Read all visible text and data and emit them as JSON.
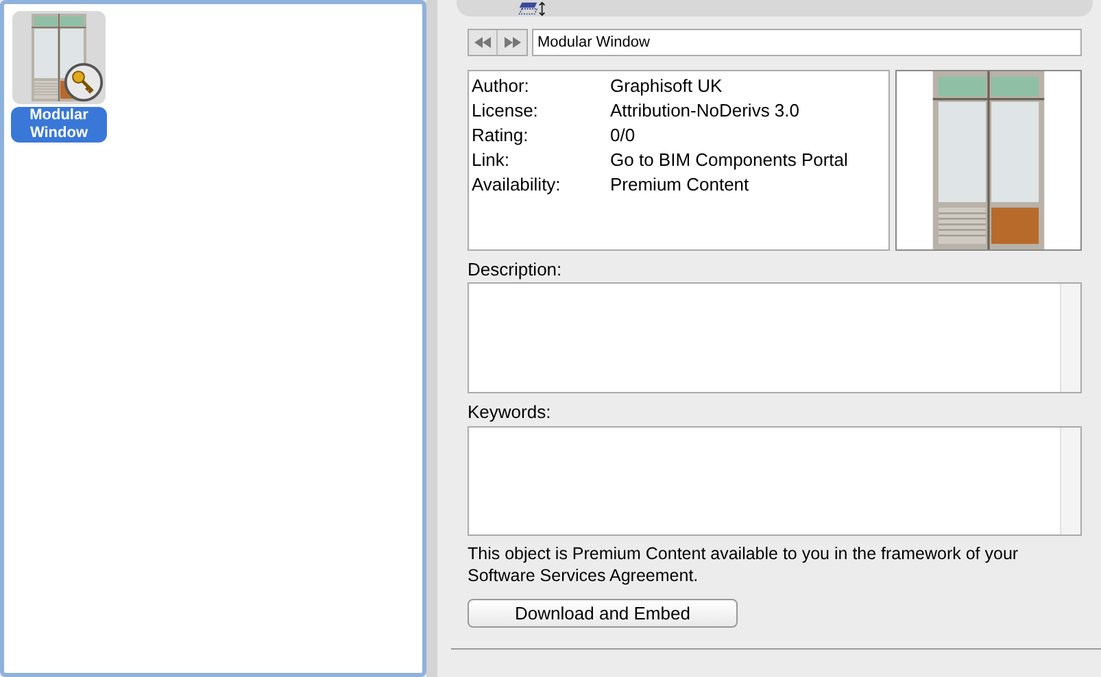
{
  "library_items": [
    {
      "label": "Modular Window",
      "selected": true,
      "premium": true
    }
  ],
  "name_field": {
    "value": "Modular Window"
  },
  "info": [
    {
      "label": "Author:",
      "value": "Graphisoft UK"
    },
    {
      "label": "License:",
      "value": "Attribution-NoDerivs 3.0"
    },
    {
      "label": "Rating:",
      "value": "0/0"
    },
    {
      "label": "Link:",
      "value": "Go to BIM Components Portal"
    },
    {
      "label": "Availability:",
      "value": "Premium Content"
    }
  ],
  "description": {
    "label": "Description:"
  },
  "keywords": {
    "label": "Keywords:"
  },
  "notice": "This object is Premium Content available to you in the framework of your Software Services Agreement.",
  "button": "Download and Embed"
}
